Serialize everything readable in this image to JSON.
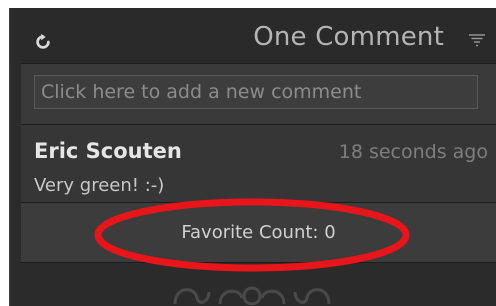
{
  "header": {
    "title": "One Comment",
    "refresh_icon": "refresh-icon",
    "menu_icon": "panel-menu-icon"
  },
  "comment_input": {
    "placeholder": "Click here to add a new comment"
  },
  "comments": [
    {
      "author": "Eric Scouten",
      "time": "18 seconds ago",
      "text": "Very green! :-)"
    }
  ],
  "favorite": {
    "label": "Favorite Count: 0"
  },
  "annotation": {
    "color": "#e8161b"
  },
  "colors": {
    "panel_bg": "#2b2b2b",
    "title_text": "#b4b4b4"
  }
}
